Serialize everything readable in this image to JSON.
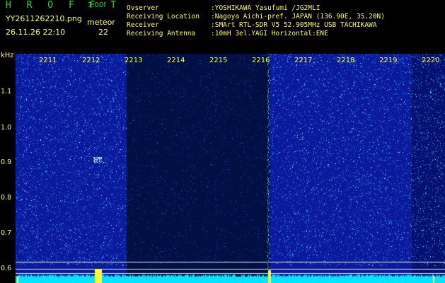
{
  "header": {
    "logo": "H R O F F T",
    "version": "1.00f",
    "filename": "YY2611262210.png",
    "meteor_label": "meteor",
    "datetime": "26.11.26 22:10",
    "meteor_count": "22",
    "info": [
      {
        "label": "Ovserver",
        "value": ":YOSHIKAWA Yasufumi /JG2MLI"
      },
      {
        "label": "Receiving Location",
        "value": ":Nagoya Aichi-pref. JAPAN (136.90E, 35.20N)"
      },
      {
        "label": "Receiver",
        "value": ":SMArt RTL-SDR V5 52.905MHz USB TACHIKAWA"
      },
      {
        "label": "Receiving Antenna",
        "value": ":10mH 3el.YAGI Horizontal:ENE"
      }
    ]
  },
  "axis": {
    "y_unit": "kHz",
    "y_ticks": [
      "1.1",
      "1.0",
      "0.9",
      "0.8",
      "0.7",
      "0.6"
    ],
    "x_ticks": [
      "2211",
      "2212",
      "2213",
      "2214",
      "2215",
      "2216",
      "2217",
      "2218",
      "2219",
      "2220"
    ]
  },
  "colors": {
    "text": "#ffff33",
    "logo": "#2bd62b",
    "background_blue": "#0a1a9a",
    "dark_band": "#00104a",
    "noise": "#00e0ff",
    "baseline": "#00e5ff"
  }
}
